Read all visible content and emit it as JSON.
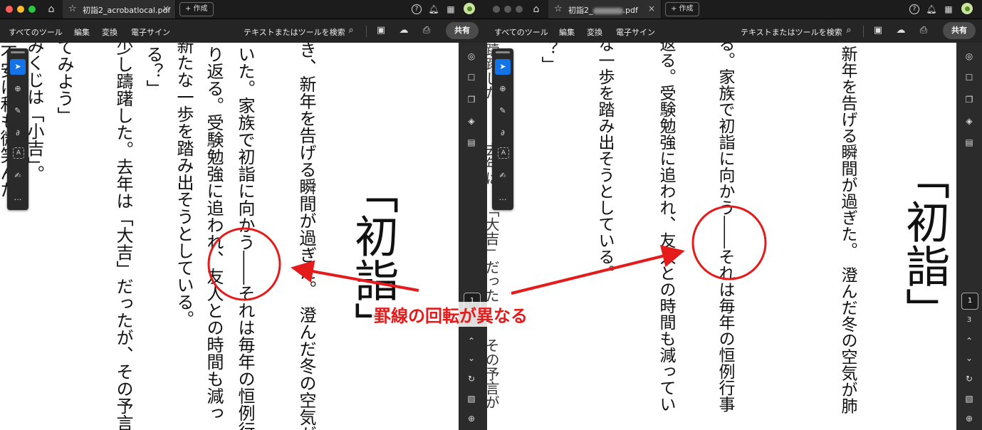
{
  "left": {
    "tab_title": "初詣2_acrobatlocal.pdf",
    "tab_close": "×",
    "new_tab": "+ 作成",
    "menu": [
      "すべてのツール",
      "編集",
      "変換",
      "電子サイン"
    ],
    "search": "テキストまたはツールを検索",
    "share": "共有",
    "page_current": "1",
    "page_total": "",
    "columns": [
      "き、新年を告げる瞬間が過ぎた。　澄んだ冬の空気が",
      "いた。家族で初詣に向かう――それは毎年の恒例行",
      "り返る。受験勉強に追われ、友人との時間も減っ",
      "新たな一歩を踏み出そうとしている。",
      "る？」",
      "少し躊躇した。去年は「大吉」だったが、その予言",
      "てみよう」",
      "みくじは「小吉」。",
      "不安に和も微笑んだ。"
    ],
    "heading": "「初詣」"
  },
  "right": {
    "tab_title_prefix": "初詣2_",
    "tab_title_suffix": ".pdf",
    "tab_close": "×",
    "new_tab": "+ 作成",
    "menu": [
      "すべてのツール",
      "編集",
      "変換",
      "電子サイン"
    ],
    "search": "テキストまたはツールを検索",
    "share": "共有",
    "page_current": "1",
    "page_total": "3",
    "heading": "「初詣」",
    "columns": [
      "新年を告げる瞬間が過ぎた。　澄んだ冬の空気が肺",
      "る。家族で初詣に向かう――それは毎年の恒例行事",
      "返る。受験勉強に追われ、友人との時間も減ってい",
      "な一歩を踏み出そうとしている。",
      "？」"
    ],
    "rail_left_partial": [
      "躊躇した",
      "去年は",
      "「大吉」だった",
      "その予言が"
    ]
  },
  "annotation": {
    "label": "罫線の回転が異なる",
    "color": "#e51b1b"
  },
  "icons": {
    "traffic": [
      "#ff5f57",
      "#febc2e",
      "#28c840"
    ],
    "tool_icons": [
      "select-icon",
      "comment-icon",
      "highlight-icon",
      "draw-icon",
      "text-select-icon",
      "sign-icon",
      "more-icon"
    ],
    "tool_glyphs": [
      "➤",
      "⊕",
      "✎",
      "∂",
      "A",
      "✍",
      "…"
    ],
    "rail_icons": [
      "ai-assistant-icon",
      "bookmark-icon",
      "pages-icon",
      "layers-icon",
      "attachment-icon"
    ],
    "rail_glyphs": [
      "◎",
      "☐",
      "❐",
      "◈",
      "▤"
    ],
    "bottom_glyphs": [
      "⌃",
      "⌄",
      "↻",
      "▧",
      "⊕"
    ]
  }
}
